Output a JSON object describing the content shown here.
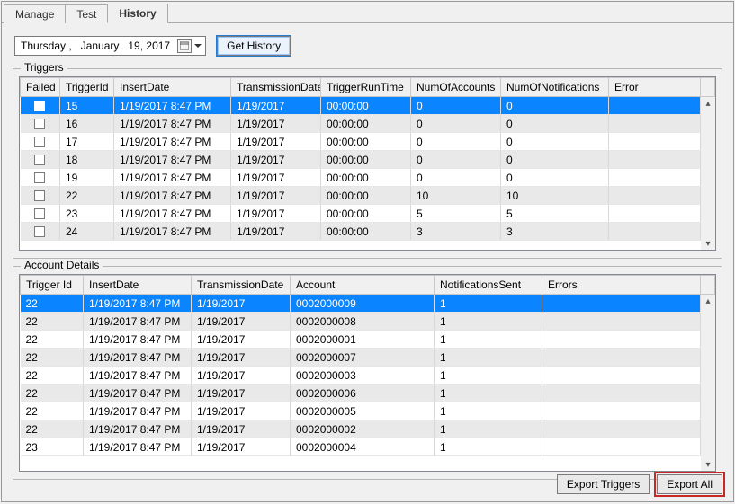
{
  "tabs": [
    "Manage",
    "Test",
    "History"
  ],
  "active_tab": 2,
  "date_display": "Thursday ,   January   19, 2017",
  "get_history_label": "Get History",
  "triggers": {
    "legend": "Triggers",
    "columns": [
      "Failed",
      "TriggerId",
      "InsertDate",
      "TransmissionDate",
      "TriggerRunTime",
      "NumOfAccounts",
      "NumOfNotifications",
      "Error"
    ],
    "rows": [
      {
        "failed": false,
        "trigger_id": "15",
        "insert_date": "1/19/2017 8:47 PM",
        "transmission_date": "1/19/2017",
        "trigger_run_time": "00:00:00",
        "num_accounts": "0",
        "num_notifications": "0",
        "error": ""
      },
      {
        "failed": false,
        "trigger_id": "16",
        "insert_date": "1/19/2017 8:47 PM",
        "transmission_date": "1/19/2017",
        "trigger_run_time": "00:00:00",
        "num_accounts": "0",
        "num_notifications": "0",
        "error": ""
      },
      {
        "failed": false,
        "trigger_id": "17",
        "insert_date": "1/19/2017 8:47 PM",
        "transmission_date": "1/19/2017",
        "trigger_run_time": "00:00:00",
        "num_accounts": "0",
        "num_notifications": "0",
        "error": ""
      },
      {
        "failed": false,
        "trigger_id": "18",
        "insert_date": "1/19/2017 8:47 PM",
        "transmission_date": "1/19/2017",
        "trigger_run_time": "00:00:00",
        "num_accounts": "0",
        "num_notifications": "0",
        "error": ""
      },
      {
        "failed": false,
        "trigger_id": "19",
        "insert_date": "1/19/2017 8:47 PM",
        "transmission_date": "1/19/2017",
        "trigger_run_time": "00:00:00",
        "num_accounts": "0",
        "num_notifications": "0",
        "error": ""
      },
      {
        "failed": false,
        "trigger_id": "22",
        "insert_date": "1/19/2017 8:47 PM",
        "transmission_date": "1/19/2017",
        "trigger_run_time": "00:00:00",
        "num_accounts": "10",
        "num_notifications": "10",
        "error": ""
      },
      {
        "failed": false,
        "trigger_id": "23",
        "insert_date": "1/19/2017 8:47 PM",
        "transmission_date": "1/19/2017",
        "trigger_run_time": "00:00:00",
        "num_accounts": "5",
        "num_notifications": "5",
        "error": ""
      },
      {
        "failed": false,
        "trigger_id": "24",
        "insert_date": "1/19/2017 8:47 PM",
        "transmission_date": "1/19/2017",
        "trigger_run_time": "00:00:00",
        "num_accounts": "3",
        "num_notifications": "3",
        "error": ""
      }
    ],
    "selected_index": 0
  },
  "details": {
    "legend": "Account Details",
    "columns": [
      "Trigger Id",
      "InsertDate",
      "TransmissionDate",
      "Account",
      "NotificationsSent",
      "Errors"
    ],
    "rows": [
      {
        "trigger_id": "22",
        "insert_date": "1/19/2017 8:47 PM",
        "transmission_date": "1/19/2017",
        "account": "0002000009",
        "notifications_sent": "1",
        "errors": ""
      },
      {
        "trigger_id": "22",
        "insert_date": "1/19/2017 8:47 PM",
        "transmission_date": "1/19/2017",
        "account": "0002000008",
        "notifications_sent": "1",
        "errors": ""
      },
      {
        "trigger_id": "22",
        "insert_date": "1/19/2017 8:47 PM",
        "transmission_date": "1/19/2017",
        "account": "0002000001",
        "notifications_sent": "1",
        "errors": ""
      },
      {
        "trigger_id": "22",
        "insert_date": "1/19/2017 8:47 PM",
        "transmission_date": "1/19/2017",
        "account": "0002000007",
        "notifications_sent": "1",
        "errors": ""
      },
      {
        "trigger_id": "22",
        "insert_date": "1/19/2017 8:47 PM",
        "transmission_date": "1/19/2017",
        "account": "0002000003",
        "notifications_sent": "1",
        "errors": ""
      },
      {
        "trigger_id": "22",
        "insert_date": "1/19/2017 8:47 PM",
        "transmission_date": "1/19/2017",
        "account": "0002000006",
        "notifications_sent": "1",
        "errors": ""
      },
      {
        "trigger_id": "22",
        "insert_date": "1/19/2017 8:47 PM",
        "transmission_date": "1/19/2017",
        "account": "0002000005",
        "notifications_sent": "1",
        "errors": ""
      },
      {
        "trigger_id": "22",
        "insert_date": "1/19/2017 8:47 PM",
        "transmission_date": "1/19/2017",
        "account": "0002000002",
        "notifications_sent": "1",
        "errors": ""
      },
      {
        "trigger_id": "23",
        "insert_date": "1/19/2017 8:47 PM",
        "transmission_date": "1/19/2017",
        "account": "0002000004",
        "notifications_sent": "1",
        "errors": ""
      }
    ],
    "selected_index": 0
  },
  "buttons": {
    "export_triggers": "Export Triggers",
    "export_all": "Export All"
  }
}
